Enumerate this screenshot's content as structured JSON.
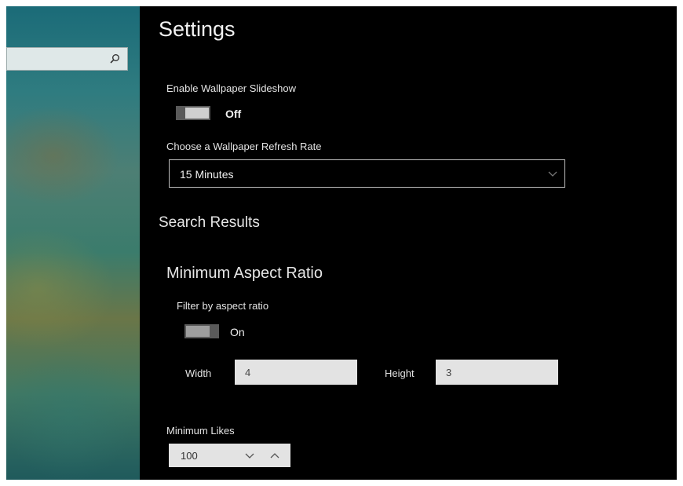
{
  "sidebar": {
    "search": {
      "value": "",
      "placeholder": ""
    }
  },
  "settings": {
    "title": "Settings",
    "slideshow": {
      "label": "Enable Wallpaper Slideshow",
      "state": "Off"
    },
    "refresh_rate": {
      "label": "Choose a Wallpaper Refresh Rate",
      "selected": "15 Minutes"
    },
    "search_results": {
      "title": "Search Results",
      "aspect_ratio": {
        "title": "Minimum Aspect Ratio",
        "filter_label": "Filter by aspect ratio",
        "filter_state": "On",
        "width_label": "Width",
        "width_value": "4",
        "height_label": "Height",
        "height_value": "3"
      },
      "likes": {
        "label": "Minimum Likes",
        "value": "100"
      }
    }
  },
  "colors": {
    "background": "#000000",
    "text": "#e6e6e6",
    "toggle_track": "#5a5a5a",
    "toggle_thumb": "#cfcfcf",
    "field": "#e3e3e3"
  },
  "icons": [
    "search-icon",
    "chevron-down-icon",
    "decrement-chevron-icon",
    "increment-chevron-icon"
  ]
}
